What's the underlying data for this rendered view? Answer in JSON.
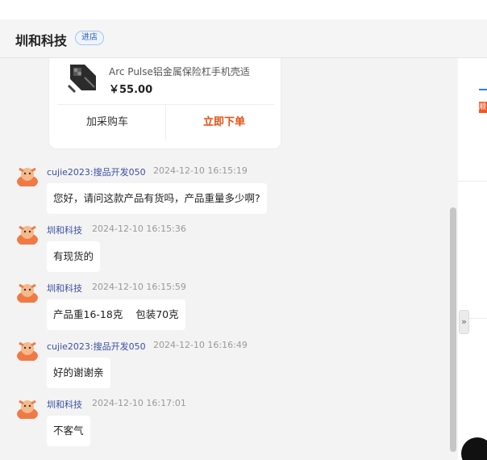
{
  "header": {
    "shop_name": "圳和科技",
    "enter_shop_label": "进店"
  },
  "product_card": {
    "title": "Arc Pulse铝金属保险杠手机壳适",
    "price": "￥55.00",
    "add_to_cart_label": "加采购车",
    "order_now_label": "立即下单"
  },
  "messages": [
    {
      "sender": "cujie2023:搜品开发050",
      "time": "2024-12-10 16:15:19",
      "text": "您好，请问这款产品有货吗，产品重量多少啊?"
    },
    {
      "sender": "圳和科技",
      "time": "2024-12-10 16:15:36",
      "text": "有现货的"
    },
    {
      "sender": "圳和科技",
      "time": "2024-12-10 16:15:59",
      "text": "产品重16-18克    包装70克"
    },
    {
      "sender": "cujie2023:搜品开发050",
      "time": "2024-12-10 16:16:49",
      "text": "好的谢谢亲"
    },
    {
      "sender": "圳和科技",
      "time": "2024-12-10 16:17:01",
      "text": "不客气"
    }
  ],
  "right_panel": {
    "badge_text": "顺"
  },
  "collapse_icon": "double-chevron-right-icon",
  "colors": {
    "accent_order": "#e84d10",
    "sender_name": "#3a4fa3",
    "badge_blue": "#2b5fc3"
  }
}
